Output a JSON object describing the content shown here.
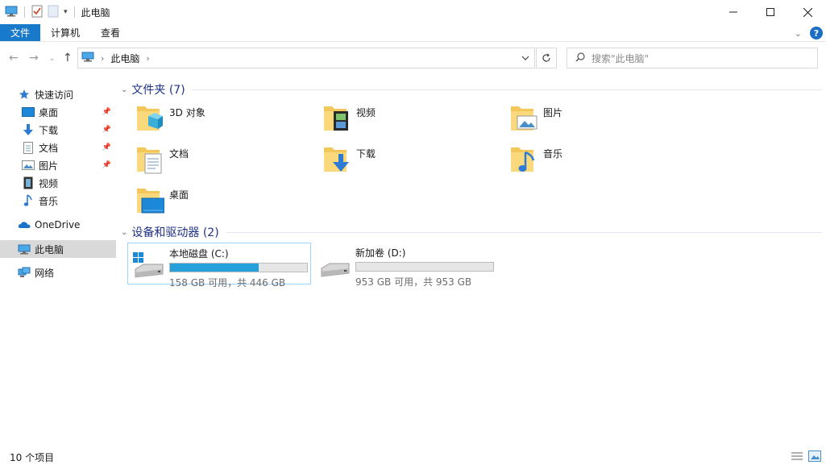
{
  "window": {
    "title": "此电脑",
    "minimize_label": "—",
    "maximize_label": "☐",
    "close_label": "✕"
  },
  "ribbon": {
    "tabs": [
      {
        "label": "文件"
      },
      {
        "label": "计算机"
      },
      {
        "label": "查看"
      }
    ],
    "help_label": "?"
  },
  "address": {
    "breadcrumb": "此电脑",
    "search_placeholder": "搜索\"此电脑\""
  },
  "sidebar": {
    "quick_access": "快速访问",
    "pinned": [
      {
        "label": "桌面"
      },
      {
        "label": "下载"
      },
      {
        "label": "文档"
      },
      {
        "label": "图片"
      }
    ],
    "unpinned": [
      {
        "label": "视频"
      },
      {
        "label": "音乐"
      }
    ],
    "onedrive": "OneDrive",
    "this_pc": "此电脑",
    "network": "网络"
  },
  "folders": {
    "header": "文件夹 (7)",
    "items": [
      {
        "label": "3D 对象"
      },
      {
        "label": "视频"
      },
      {
        "label": "图片"
      },
      {
        "label": "文档"
      },
      {
        "label": "下载"
      },
      {
        "label": "音乐"
      },
      {
        "label": "桌面"
      }
    ]
  },
  "drives": {
    "header": "设备和驱动器 (2)",
    "items": [
      {
        "name": "本地磁盘 (C:)",
        "size_text": "158 GB 可用，共 446 GB",
        "used_fraction": 0.646
      },
      {
        "name": "新加卷 (D:)",
        "size_text": "953 GB 可用，共 953 GB",
        "used_fraction": 0.0
      }
    ]
  },
  "status": {
    "item_count": "10 个项目"
  },
  "colors": {
    "accent": "#1979ca",
    "header_blue": "#1e3287",
    "bar_fill": "#26a0da",
    "selection": "#d9d9d9"
  }
}
